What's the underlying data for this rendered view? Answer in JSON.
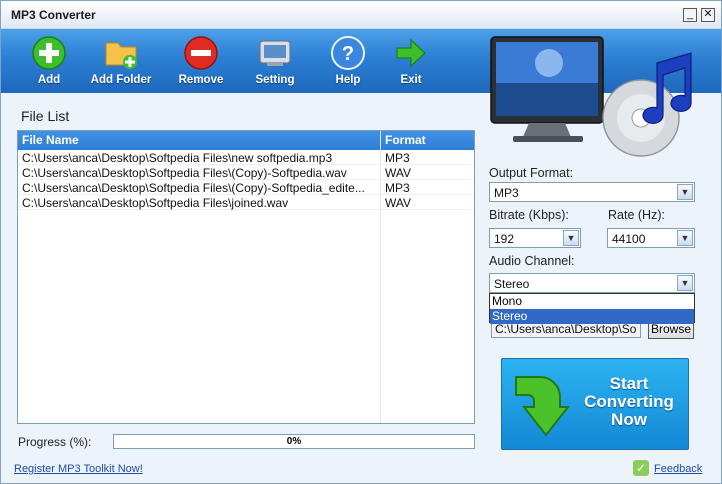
{
  "window": {
    "title": "MP3 Converter",
    "minimize_glyph": "_",
    "close_glyph": "✕"
  },
  "toolbar": {
    "items": [
      {
        "label": "Add",
        "icon": "add-icon"
      },
      {
        "label": "Add Folder",
        "icon": "add-folder-icon"
      },
      {
        "label": "Remove",
        "icon": "remove-icon"
      },
      {
        "label": "Setting",
        "icon": "setting-icon"
      },
      {
        "label": "Help",
        "icon": "help-icon"
      },
      {
        "label": "Exit",
        "icon": "exit-icon"
      }
    ]
  },
  "filelist": {
    "title": "File List",
    "columns": [
      "File Name",
      "Format"
    ],
    "rows": [
      {
        "name": "C:\\Users\\anca\\Desktop\\Softpedia Files\\new softpedia.mp3",
        "format": "MP3"
      },
      {
        "name": "C:\\Users\\anca\\Desktop\\Softpedia Files\\(Copy)-Softpedia.wav",
        "format": "WAV"
      },
      {
        "name": "C:\\Users\\anca\\Desktop\\Softpedia Files\\(Copy)-Softpedia_edite...",
        "format": "MP3"
      },
      {
        "name": "C:\\Users\\anca\\Desktop\\Softpedia Files\\joined.wav",
        "format": "WAV"
      }
    ]
  },
  "settings": {
    "output_format_label": "Output Format:",
    "output_format_value": "MP3",
    "bitrate_label": "Bitrate (Kbps):",
    "bitrate_value": "192",
    "rate_label": "Rate (Hz):",
    "rate_value": "44100",
    "channel_label": "Audio Channel:",
    "channel_value": "Stereo",
    "channel_options": [
      "Mono",
      "Stereo"
    ],
    "output_path": "C:\\Users\\anca\\Desktop\\So",
    "browse_label": "Browse",
    "dropdown_arrow": "▼"
  },
  "progress": {
    "label": "Progress (%):",
    "value_text": "0%",
    "value": 0
  },
  "start": {
    "line1": "Start",
    "line2": "Converting",
    "line3": "Now"
  },
  "footer": {
    "register_label": "Register MP3 Toolkit Now!",
    "feedback_label": "Feedback",
    "feedback_glyph": "✓"
  },
  "colors": {
    "toolbar": "#2c7fd3",
    "header": "#3f92e6",
    "start_button": "#1e9ae4",
    "selection": "#3169c6"
  }
}
